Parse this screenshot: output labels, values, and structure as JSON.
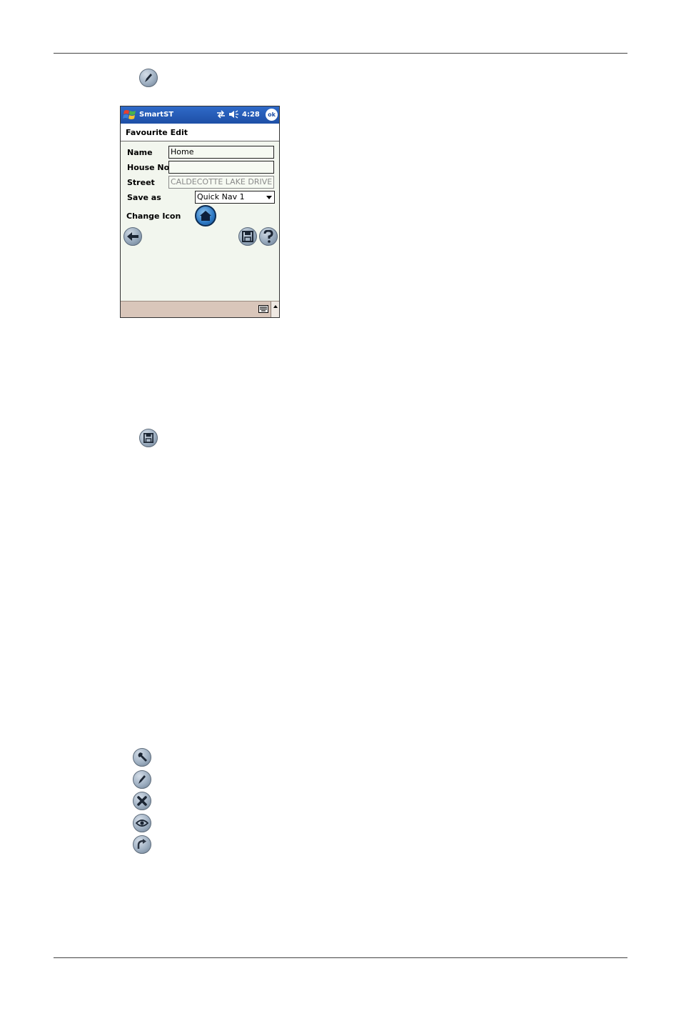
{
  "icons": {
    "top_edit": "pencil-icon",
    "save": "save-disk-icon",
    "list": [
      "wrench-icon",
      "pencil-icon",
      "x-delete-icon",
      "eye-icon",
      "curved-arrow-icon"
    ]
  },
  "phone": {
    "app_title": "SmartST",
    "clock": "4:28",
    "ok_label": "ok",
    "header": "Favourite Edit",
    "fields": {
      "name_label": "Name",
      "name_value": "Home",
      "house_label": "House No",
      "house_value": "",
      "street_label": "Street",
      "street_value": "CALDECOTTE LAKE DRIVE",
      "save_as_label": "Save as",
      "save_as_value": "Quick Nav 1",
      "change_icon_label": "Change Icon"
    }
  },
  "colors": {
    "titlebar": "#1e4fa6",
    "screen_bg": "#f2f6ee",
    "taskbar": "#d9c6ba"
  }
}
